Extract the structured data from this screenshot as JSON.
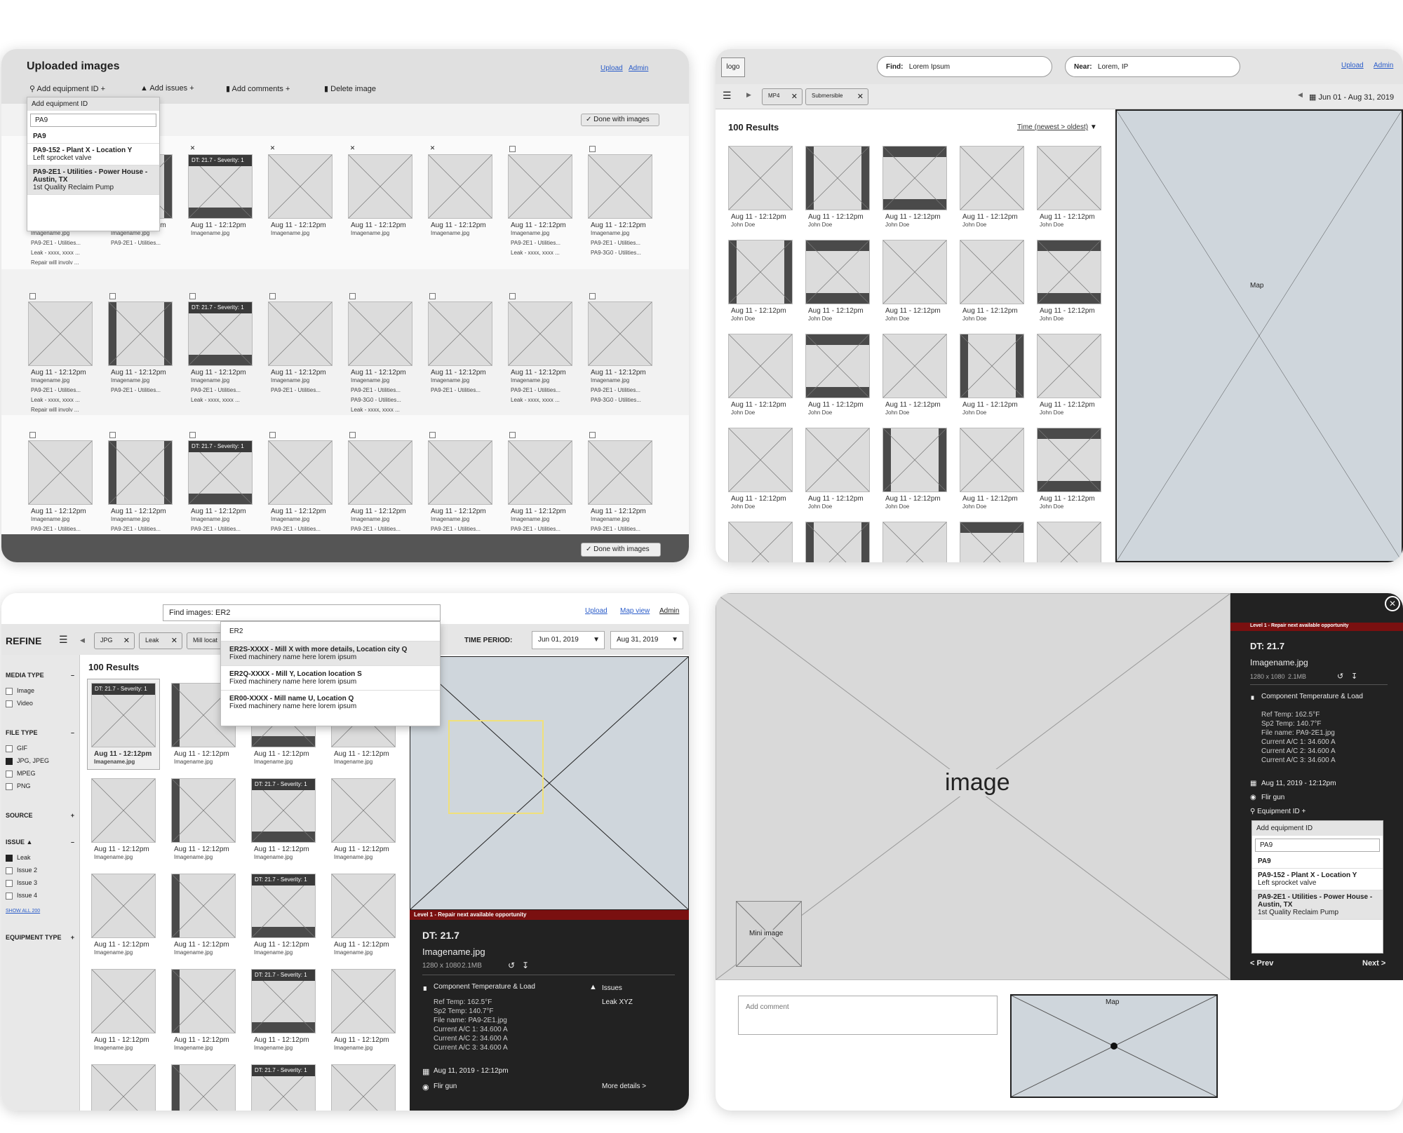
{
  "p1": {
    "title": "Uploaded images",
    "upload": "Upload",
    "admin": "Admin",
    "toolbar": {
      "add_equipment": "Add equipment ID",
      "add_issues": "Add issues",
      "add_comments": "Add comments",
      "delete": "Delete image",
      "plus": "+"
    },
    "done": "Done with images",
    "dropdown": {
      "header": "Add equipment ID",
      "value": "PA9",
      "options": [
        {
          "title": "PA9",
          "sub": ""
        },
        {
          "title": "PA9-152 - Plant X - Location Y",
          "sub": "Left sprocket valve"
        },
        {
          "title": "PA9-2E1 - Utilities - Power House - Austin, TX",
          "sub": "1st Quality Reclaim Pump"
        }
      ]
    },
    "dt_badge": "DT: 21.7 - Severity: 1",
    "cap_date": "Aug 11 - 12:12pm",
    "cap_file": "Imagename.jpg",
    "tag_loc1": "PA9-2E1 - Utilities...",
    "tag_loc2": "PA9-3G0 - Utilities...",
    "tag_leak": "Leak - xxxx, xxxx ...",
    "tag_repair": "Repair will involv ..."
  },
  "p2": {
    "logo": "logo",
    "find_label": "Find:",
    "find_value": "Lorem Ipsum",
    "near_label": "Near:",
    "near_value": "Lorem, IP",
    "upload": "Upload",
    "admin": "Admin",
    "chips": [
      "MP4",
      "Submersible"
    ],
    "date_range": "Jun 01 - Aug 31, 2019",
    "results": "100 Results",
    "sort": "Time (newest > oldest)",
    "map": "Map",
    "cap_date": "Aug 11 - 12:12pm",
    "cap_user": "John Doe"
  },
  "p3": {
    "find": "Find images: ER2",
    "upload": "Upload",
    "mapview": "Map view",
    "admin": "Admin",
    "refine": "REFINE",
    "chips": [
      "JPG",
      "Leak",
      "Mill locat"
    ],
    "time_period": "TIME PERIOD:",
    "date_from": "Jun 01, 2019",
    "date_to": "Aug 31, 2019",
    "results": "100 Results",
    "search_dd": {
      "query": "ER2",
      "options": [
        {
          "title": "ER2S-XXXX - Mill X with more details, Location city Q",
          "sub": "Fixed machinery name here lorem ipsum"
        },
        {
          "title": "ER2Q-XXXX - Mill Y, Location location S",
          "sub": "Fixed machinery name here lorem ipsum"
        },
        {
          "title": "ER00-XXXX - Mill name U, Location Q",
          "sub": "Fixed machinery name here lorem ipsum"
        }
      ]
    },
    "sidebar": {
      "media_type": "MEDIA TYPE",
      "media": [
        "Image",
        "Video"
      ],
      "file_type": "FILE TYPE",
      "files": [
        {
          "label": "GIF",
          "checked": false
        },
        {
          "label": "JPG, JPEG",
          "checked": true
        },
        {
          "label": "MPEG",
          "checked": false
        },
        {
          "label": "PNG",
          "checked": false
        }
      ],
      "source": "SOURCE",
      "issue": "ISSUE",
      "issues": [
        {
          "label": "Leak",
          "checked": true
        },
        {
          "label": "Issue 2",
          "checked": false
        },
        {
          "label": "Issue 3",
          "checked": false
        },
        {
          "label": "Issue 4",
          "checked": false
        }
      ],
      "show_all": "SHOW ALL 200",
      "equipment_type": "EQUIPMENT TYPE"
    },
    "detail": {
      "level": "Level 1 - Repair next available opportunity",
      "dt": "DT: 21.7",
      "name": "Imagename.jpg",
      "dims": "1280 x 1080",
      "size": "2.1MB",
      "comp": "Component Temperature & Load",
      "stats": [
        "Ref Temp: 162.5°F",
        "Sp2 Temp: 140.7°F",
        "File name: PA9-2E1.jpg",
        "Current A/C 1: 34.600 A",
        "Current A/C 2: 34.600 A",
        "Current A/C 3: 34.600 A"
      ],
      "issues_label": "Issues",
      "issue_val": "Leak XYZ",
      "date": "Aug 11, 2019 - 12:12pm",
      "camera": "Flir gun",
      "more": "More details >"
    },
    "dt_badge": "DT: 21.7 - Severity: 1",
    "cap_date": "Aug 11 - 12:12pm",
    "cap_file": "Imagename.jpg"
  },
  "p4": {
    "image": "image",
    "mini": "Mini image",
    "level": "Level 1 - Repair next available opportunity",
    "dt": "DT: 21.7",
    "name": "Imagename.jpg",
    "dims": "1280 x 1080",
    "size": "2.1MB",
    "comp": "Component Temperature & Load",
    "stats": [
      "Ref Temp: 162.5°F",
      "Sp2 Temp: 140.7°F",
      "File name: PA9-2E1.jpg",
      "Current A/C 1: 34.600 A",
      "Current A/C 2: 34.600 A",
      "Current A/C 3: 34.600 A"
    ],
    "date": "Aug 11, 2019 - 12:12pm",
    "camera": "Flir gun",
    "equip": "Equipment ID",
    "dropdown": {
      "header": "Add equipment ID",
      "value": "PA9",
      "options": [
        {
          "title": "PA9",
          "sub": ""
        },
        {
          "title": "PA9-152 - Plant X - Location Y",
          "sub": "Left sprocket valve"
        },
        {
          "title": "PA9-2E1 - Utilities - Power House - Austin, TX",
          "sub": "1st Quality Reclaim Pump"
        }
      ]
    },
    "prev": "< Prev",
    "next": "Next >",
    "comment_placeholder": "Add comment",
    "map": "Map"
  }
}
